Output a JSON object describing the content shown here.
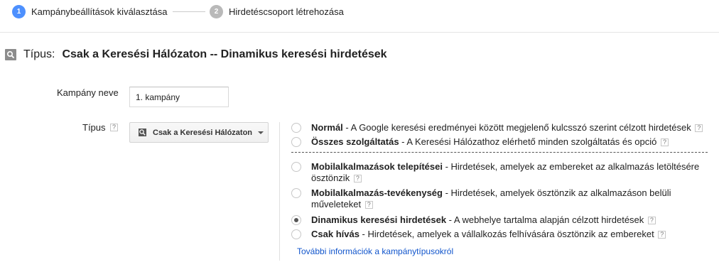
{
  "stepper": {
    "steps": [
      {
        "number": "1",
        "label": "Kampánybeállítások kiválasztása",
        "state": "active"
      },
      {
        "number": "2",
        "label": "Hirdetéscsoport létrehozása",
        "state": "inactive"
      }
    ]
  },
  "section": {
    "type_label": "Típus:",
    "type_value": "Csak a Keresési Hálózaton -- Dinamikus keresési hirdetések",
    "icon": "search-icon"
  },
  "form": {
    "campaign_name_label": "Kampány neve",
    "campaign_name_value": "1. kampány",
    "type_label": "Típus",
    "help_glyph": "?",
    "type_dropdown": {
      "selected": "Csak a Keresési Hálózaton",
      "icon": "search-icon"
    }
  },
  "options": [
    {
      "title": "Normál",
      "desc": " - A Google keresési eredményei között megjelenő kulcsszó szerint célzott hirdetések",
      "selected": false
    },
    {
      "title": "Összes szolgáltatás",
      "desc": " - A Keresési Hálózathoz elérhető minden szolgáltatás és opció",
      "selected": false
    },
    {
      "title": "Mobilalkalmazások telepítései",
      "desc": " - Hirdetések, amelyek az embereket az alkalmazás letöltésére ösztönzik",
      "selected": false
    },
    {
      "title": "Mobilalkalmazás-tevékenység",
      "desc": " - Hirdetések, amelyek ösztönzik az alkalmazáson belüli műveleteket",
      "selected": false
    },
    {
      "title": "Dinamikus keresési hirdetések",
      "desc": " - A webhelye tartalma alapján célzott hirdetések",
      "selected": true
    },
    {
      "title": "Csak hívás",
      "desc": " - Hirdetések, amelyek a vállalkozás felhívására ösztönzik az embereket",
      "selected": false
    }
  ],
  "more_info_link": "További információk a kampánytípusokról",
  "colors": {
    "accent": "#4d90fe",
    "inactive_step": "#b9b9b9",
    "link": "#1155cc"
  }
}
